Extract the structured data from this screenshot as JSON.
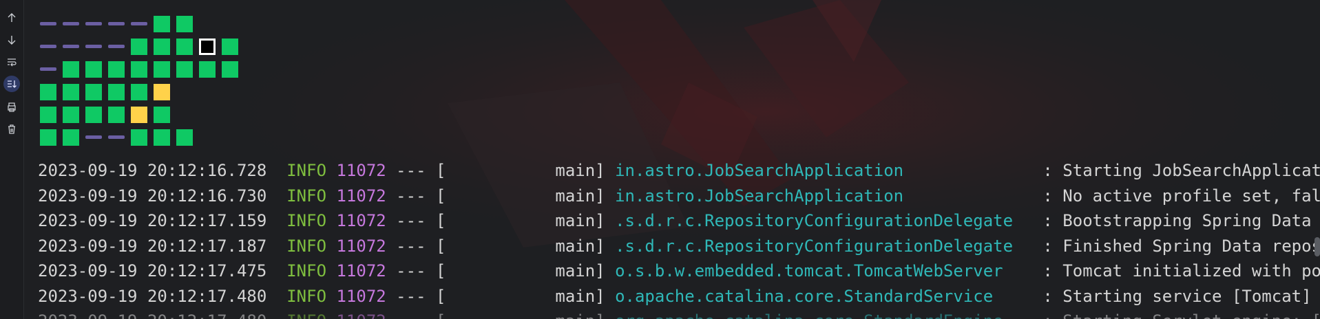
{
  "toolbar": {
    "buttons": [
      {
        "name": "scroll-up-button",
        "icon": "arrow-up-icon"
      },
      {
        "name": "scroll-down-button",
        "icon": "arrow-down-icon"
      },
      {
        "name": "soft-wrap-button",
        "icon": "soft-wrap-icon"
      },
      {
        "name": "scroll-to-end-button",
        "icon": "scroll-to-end-icon",
        "active": true
      },
      {
        "name": "print-button",
        "icon": "print-icon"
      },
      {
        "name": "clear-all-button",
        "icon": "trash-icon"
      }
    ]
  },
  "banner": {
    "rows": [
      "dddddgg",
      "ddddgggwg",
      "dgggggggg",
      "gggggy",
      "ggggyg",
      "ggddggg"
    ],
    "colors": {
      "green": "#0fc964",
      "yellow": "#ffd24a",
      "dash": "#6b5fa3"
    }
  },
  "log": {
    "colors": {
      "info": "#7fbf3f",
      "pid": "#c678dd",
      "logger": "#2fb8b8",
      "text": "#d4d4d4"
    },
    "lines": [
      {
        "timestamp": "2023-09-19 20:12:16.728",
        "level": "INFO",
        "pid": "11072",
        "sep": "--- [",
        "thread": "           main]",
        "logger": "in.astro.JobSearchApplication",
        "pad": "             ",
        "message": ": Starting JobSearchApplication us"
      },
      {
        "timestamp": "2023-09-19 20:12:16.730",
        "level": "INFO",
        "pid": "11072",
        "sep": "--- [",
        "thread": "           main]",
        "logger": "in.astro.JobSearchApplication",
        "pad": "             ",
        "message": ": No active profile set, falling b"
      },
      {
        "timestamp": "2023-09-19 20:12:17.159",
        "level": "INFO",
        "pid": "11072",
        "sep": "--- [",
        "thread": "           main]",
        "logger": ".s.d.r.c.RepositoryConfigurationDelegate",
        "pad": "  ",
        "message": ": Bootstrapping Spring Data MongoD"
      },
      {
        "timestamp": "2023-09-19 20:12:17.187",
        "level": "INFO",
        "pid": "11072",
        "sep": "--- [",
        "thread": "           main]",
        "logger": ".s.d.r.c.RepositoryConfigurationDelegate",
        "pad": "  ",
        "message": ": Finished Spring Data repository"
      },
      {
        "timestamp": "2023-09-19 20:12:17.475",
        "level": "INFO",
        "pid": "11072",
        "sep": "--- [",
        "thread": "           main]",
        "logger": "o.s.b.w.embedded.tomcat.TomcatWebServer",
        "pad": "   ",
        "message": ": Tomcat initialized with port(s):"
      },
      {
        "timestamp": "2023-09-19 20:12:17.480",
        "level": "INFO",
        "pid": "11072",
        "sep": "--- [",
        "thread": "           main]",
        "logger": "o.apache.catalina.core.StandardService",
        "pad": "    ",
        "message": ": Starting service [Tomcat]"
      },
      {
        "timestamp": "2023-09-19 20:12:17.480",
        "level": "INFO",
        "pid": "11072",
        "sep": "--- [",
        "thread": "           main]",
        "logger": "org.apache.catalina.core.StandardEngine",
        "pad": "   ",
        "message": ": Starting Servlet engine: [Apache"
      }
    ]
  }
}
